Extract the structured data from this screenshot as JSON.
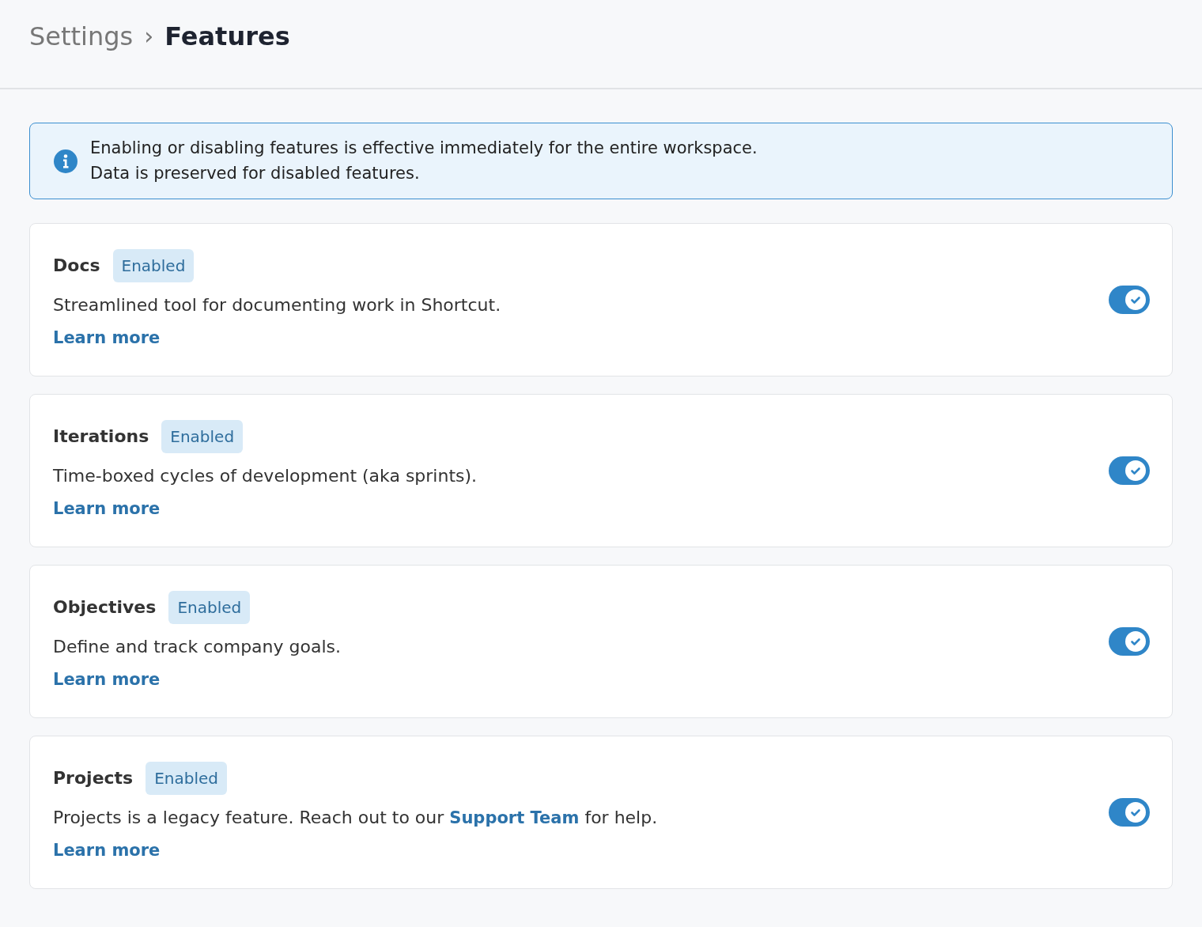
{
  "breadcrumb": {
    "parent": "Settings",
    "separator": "›",
    "current": "Features"
  },
  "notice": {
    "lines": [
      "Enabling or disabling features is effective immediately for the entire workspace.",
      "Data is preserved for disabled features."
    ]
  },
  "features": [
    {
      "name": "Docs",
      "status": "Enabled",
      "description": [
        {
          "kind": "text",
          "text": "Streamlined tool for documenting work in Shortcut."
        }
      ],
      "link": "Learn more",
      "on": true
    },
    {
      "name": "Iterations",
      "status": "Enabled",
      "description": [
        {
          "kind": "text",
          "text": "Time-boxed cycles of development (aka sprints)."
        }
      ],
      "link": "Learn more",
      "on": true
    },
    {
      "name": "Objectives",
      "status": "Enabled",
      "description": [
        {
          "kind": "text",
          "text": "Define and track company goals."
        }
      ],
      "link": "Learn more",
      "on": true
    },
    {
      "name": "Projects",
      "status": "Enabled",
      "description": [
        {
          "kind": "text",
          "text": "Projects is a legacy feature. Reach out to our "
        },
        {
          "kind": "link",
          "text": "Support Team"
        },
        {
          "kind": "text",
          "text": " for help."
        }
      ],
      "link": "Learn more",
      "on": true
    }
  ]
}
